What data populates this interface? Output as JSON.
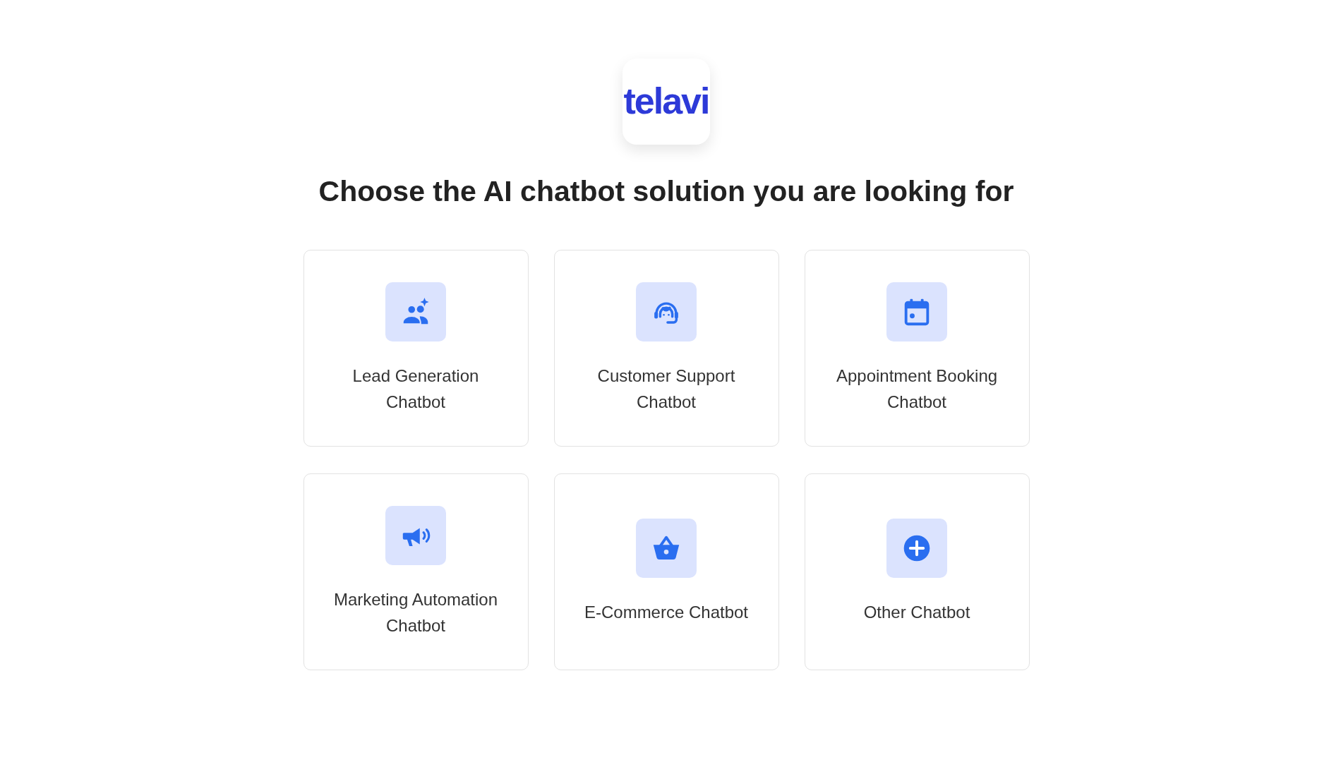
{
  "logo": {
    "text": "telavi"
  },
  "heading": "Choose the AI chatbot solution you are looking for",
  "options": [
    {
      "label": "Lead Generation Chatbot"
    },
    {
      "label": "Customer Support Chatbot"
    },
    {
      "label": "Appointment Booking Chatbot"
    },
    {
      "label": "Marketing Automation Chatbot"
    },
    {
      "label": "E-Commerce Chatbot"
    },
    {
      "label": "Other Chatbot"
    }
  ]
}
